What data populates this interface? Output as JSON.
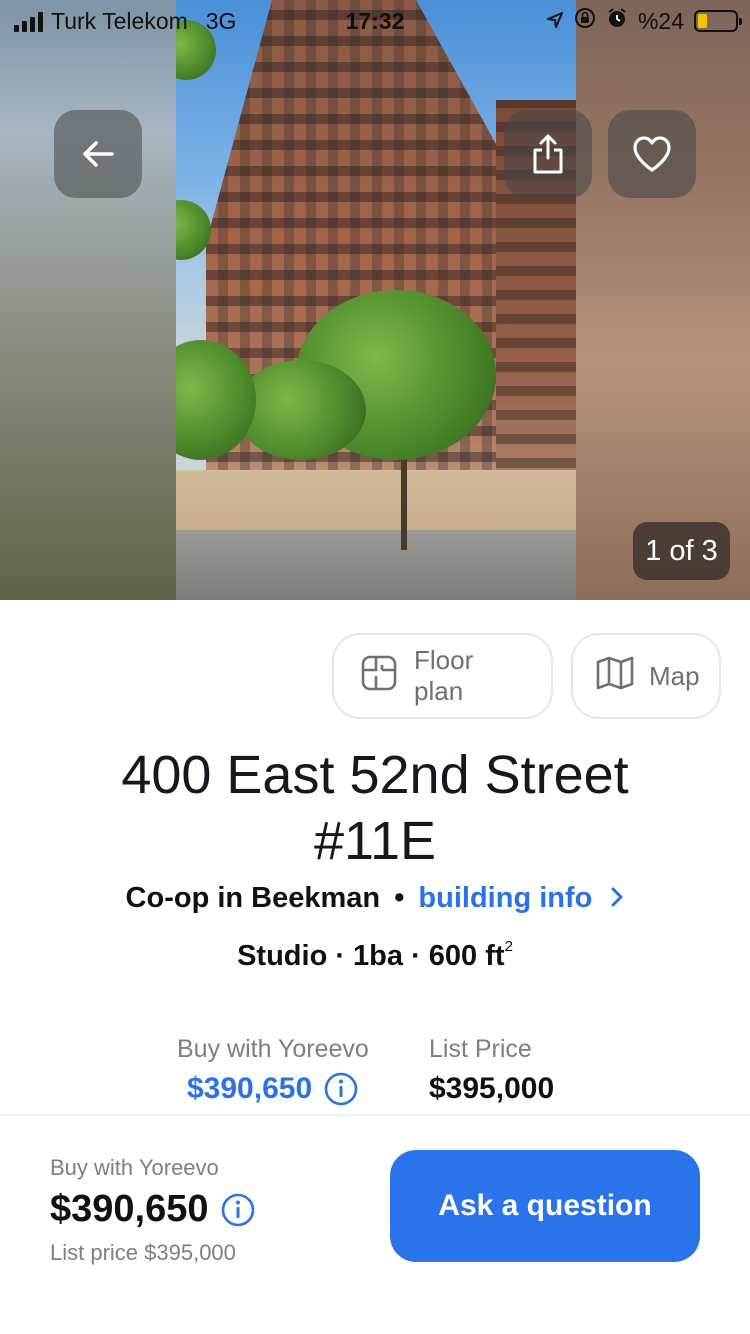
{
  "status_bar": {
    "carrier": "Turk Telekom",
    "network": "3G",
    "time": "17:32",
    "battery_text": "%24"
  },
  "gallery": {
    "counter": "1 of 3",
    "back_icon": "arrow-left-icon",
    "share_icon": "share-icon",
    "favorite_icon": "heart-icon"
  },
  "actions": {
    "floor_plan_label": "Floor plan",
    "map_label": "Map"
  },
  "listing": {
    "title_line1": "400 East 52nd Street",
    "title_line2": "#11E",
    "type_text": "Co-op in Beekman",
    "separator": "•",
    "building_info_label": "building info",
    "facts_main": "Studio · 1ba · 600 ft",
    "facts_sup": "2"
  },
  "prices": {
    "yoreevo_label": "Buy with Yoreevo",
    "yoreevo_price": "$390,650",
    "list_label": "List Price",
    "list_price": "$395,000"
  },
  "bottom_bar": {
    "label": "Buy with Yoreevo",
    "price": "$390,650",
    "list_price_text": "List price $395,000",
    "ask_button": "Ask a question"
  },
  "colors": {
    "accent": "#2a73ea",
    "link": "#2b72e6",
    "muted": "#7a7f88"
  }
}
